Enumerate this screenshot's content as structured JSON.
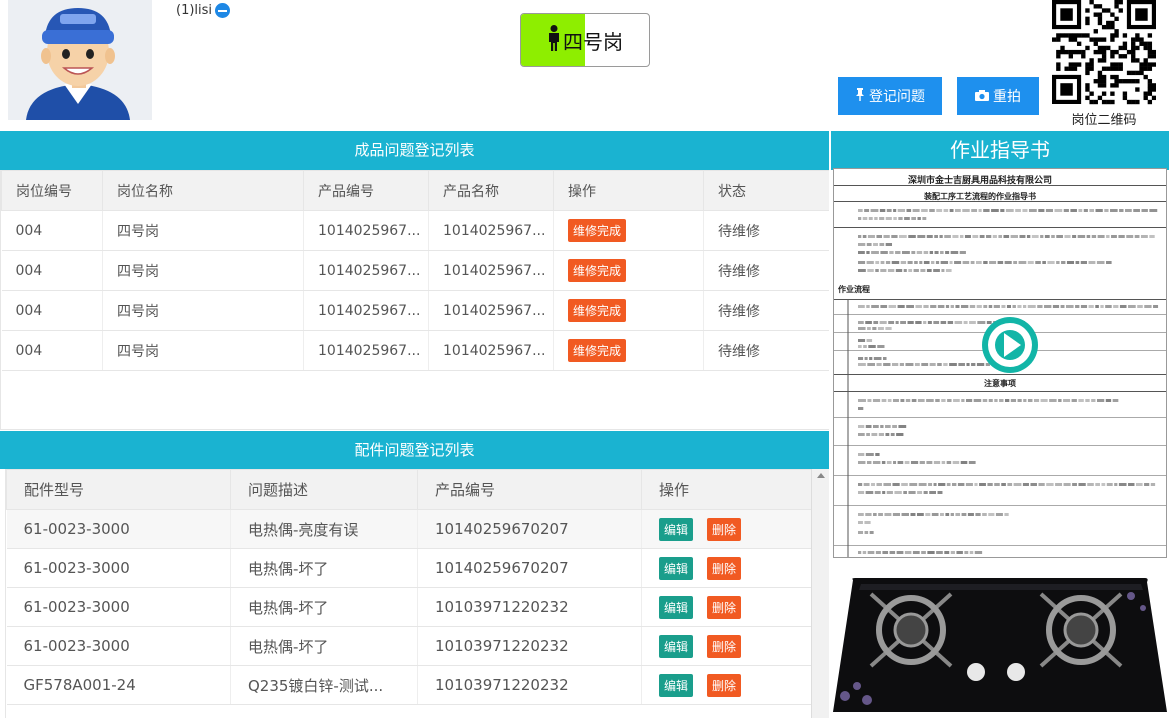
{
  "header": {
    "user": "(1)lisi",
    "station_name": "四号岗",
    "station_fill_fraction": 0.5,
    "btn_register": "登记问题",
    "btn_retake": "重拍",
    "qr_label": "岗位二维码"
  },
  "product_issues": {
    "title": "成品问题登记列表",
    "columns": [
      "岗位编号",
      "岗位名称",
      "产品编号",
      "产品名称",
      "操作",
      "状态"
    ],
    "rows": [
      {
        "station_no": "004",
        "station_name": "四号岗",
        "product_no": "1014025967...",
        "product_name": "1014025967...",
        "action": "维修完成",
        "status": "待维修"
      },
      {
        "station_no": "004",
        "station_name": "四号岗",
        "product_no": "1014025967...",
        "product_name": "1014025967...",
        "action": "维修完成",
        "status": "待维修"
      },
      {
        "station_no": "004",
        "station_name": "四号岗",
        "product_no": "1014025967...",
        "product_name": "1014025967...",
        "action": "维修完成",
        "status": "待维修"
      },
      {
        "station_no": "004",
        "station_name": "四号岗",
        "product_no": "1014025967...",
        "product_name": "1014025967...",
        "action": "维修完成",
        "status": "待维修"
      }
    ]
  },
  "part_issues": {
    "title": "配件问题登记列表",
    "columns": [
      "配件型号",
      "问题描述",
      "产品编号",
      "操作"
    ],
    "edit_label": "编辑",
    "delete_label": "删除",
    "rows": [
      {
        "model": "61-0023-3000",
        "desc": "电热偶-亮度有误",
        "product_no": "10140259670207"
      },
      {
        "model": "61-0023-3000",
        "desc": "电热偶-坏了",
        "product_no": "10140259670207"
      },
      {
        "model": "61-0023-3000",
        "desc": "电热偶-坏了",
        "product_no": "10103971220232"
      },
      {
        "model": "61-0023-3000",
        "desc": "电热偶-坏了",
        "product_no": "10103971220232"
      },
      {
        "model": "GF578A001-24",
        "desc": "Q235镀白锌-测试...",
        "product_no": "10103971220232"
      }
    ]
  },
  "guide": {
    "title": "作业指导书",
    "doc_company": "深圳市金士吉厨具用品科技有限公司",
    "doc_title": "装配工序工艺流程的作业指导书",
    "doc_section_1": "作业流程",
    "doc_section_2": "注意事项"
  },
  "colors": {
    "accent": "#1ab3d1",
    "button_blue": "#1e90ee",
    "tag_orange": "#f15a22",
    "tag_green": "#1a9e8c",
    "station_green": "#8eee00"
  }
}
